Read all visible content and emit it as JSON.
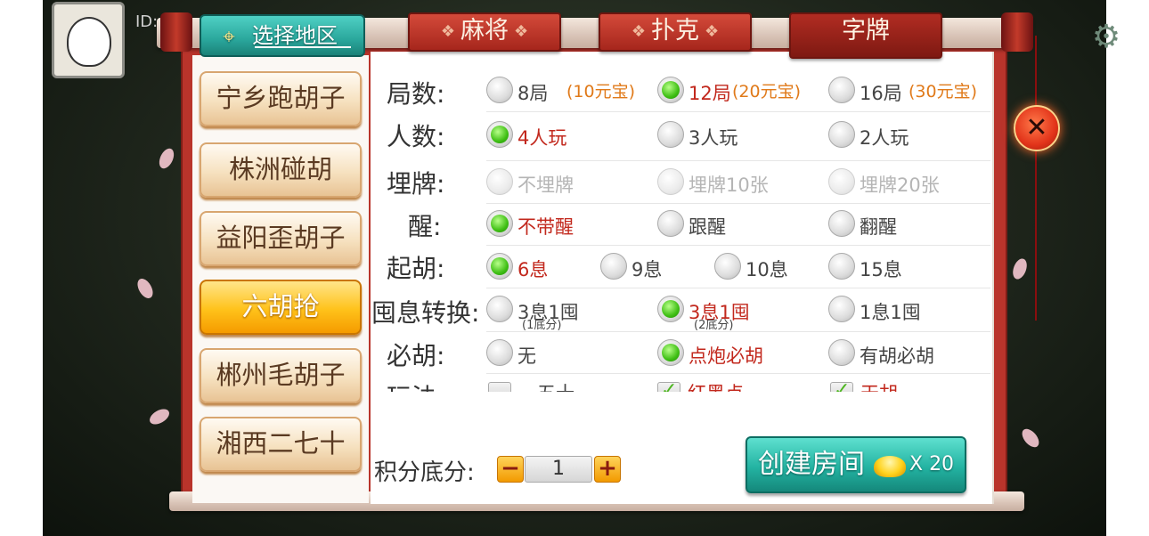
{
  "header": {
    "user_id_label": "ID:"
  },
  "region_tab": {
    "label": "选择地区"
  },
  "category_tabs": [
    {
      "label": "麻将"
    },
    {
      "label": "扑克"
    },
    {
      "label": "字牌"
    }
  ],
  "games": [
    {
      "label": "宁乡跑胡子"
    },
    {
      "label": "株洲碰胡"
    },
    {
      "label": "益阳歪胡子"
    },
    {
      "label": "六胡抢"
    },
    {
      "label": "郴州毛胡子"
    },
    {
      "label": "湘西二七十"
    }
  ],
  "rows": {
    "rounds": {
      "label": "局数:",
      "options": [
        {
          "text": "8局",
          "cost": "(10元宝)"
        },
        {
          "text": "12局",
          "cost": "(20元宝)"
        },
        {
          "text": "16局",
          "cost": "(30元宝)"
        }
      ]
    },
    "players": {
      "label": "人数:",
      "options": [
        "4人玩",
        "3人玩",
        "2人玩"
      ]
    },
    "bury": {
      "label": "埋牌:",
      "options": [
        "不埋牌",
        "埋牌10张",
        "埋牌20张"
      ]
    },
    "xing": {
      "label": "醒:",
      "options": [
        "不带醒",
        "跟醒",
        "翻醒"
      ]
    },
    "qihu": {
      "label": "起胡:",
      "options": [
        "6息",
        "9息",
        "10息",
        "15息"
      ]
    },
    "conversion": {
      "label": "囤息转换:",
      "options": [
        {
          "text": "3息1囤",
          "sub": "(1底分)"
        },
        {
          "text": "3息1囤",
          "sub": "(2底分)"
        },
        {
          "text": "1息1囤",
          "sub": ""
        }
      ]
    },
    "bihu": {
      "label": "必胡:",
      "options": [
        "无",
        "点炮必胡",
        "有胡必胡"
      ]
    },
    "play": {
      "label": "玩法:",
      "options": [
        "一五十",
        "红黑点",
        "天胡"
      ]
    }
  },
  "score": {
    "label": "积分底分:",
    "minus": "−",
    "plus": "+",
    "value": "1"
  },
  "create": {
    "label": "创建房间",
    "multiplier": "X 20"
  },
  "close": {
    "symbol": "✕"
  },
  "colors": {
    "teal": "#23b3a2",
    "red": "#b9342b",
    "selected_text": "#c2281d",
    "cost": "#e07a1a"
  }
}
